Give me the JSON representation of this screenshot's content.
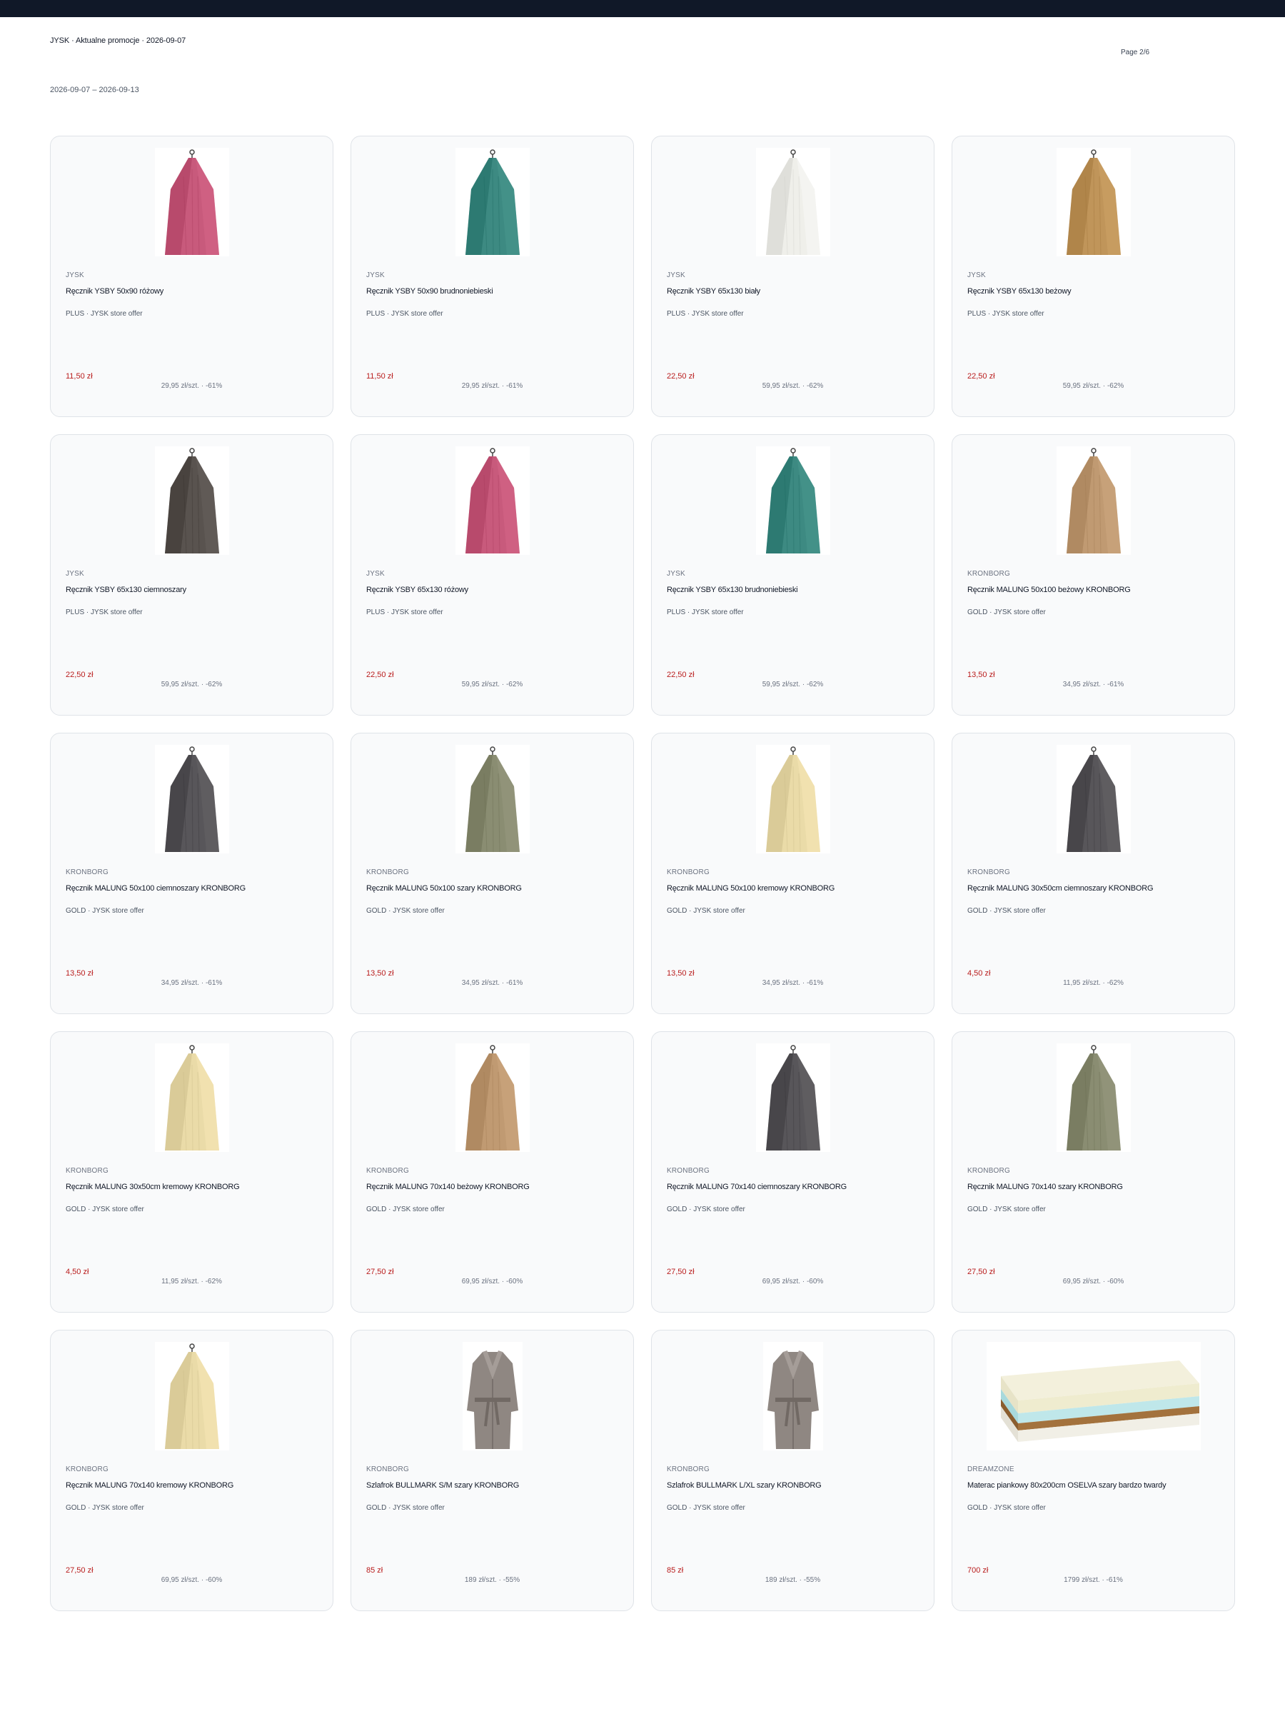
{
  "header": {
    "title": "JYSK · Aktualne promocje · 2026-09-07",
    "page": "Page 2/6",
    "date_range": "2026-09-07 – 2026-09-13"
  },
  "products": [
    {
      "brand": "JYSK",
      "name": "Ręcznik YSBY 50x90 różowy",
      "offer": "PLUS · JYSK store offer",
      "price": "11,50 zł",
      "old": "29,95 zł/szt. · -61%",
      "image": "towel",
      "color": "#c85a7c"
    },
    {
      "brand": "JYSK",
      "name": "Ręcznik YSBY 50x90 brudnoniebieski",
      "offer": "PLUS · JYSK store offer",
      "price": "11,50 zł",
      "old": "29,95 zł/szt. · -61%",
      "image": "towel",
      "color": "#3d8a82"
    },
    {
      "brand": "JYSK",
      "name": "Ręcznik YSBY 65x130 biały",
      "offer": "PLUS · JYSK store offer",
      "price": "22,50 zł",
      "old": "59,95 zł/szt. · -62%",
      "image": "towel",
      "color": "#efefea"
    },
    {
      "brand": "JYSK",
      "name": "Ręcznik YSBY 65x130 beżowy",
      "offer": "PLUS · JYSK store offer",
      "price": "22,50 zł",
      "old": "59,95 zł/szt. · -62%",
      "image": "towel",
      "color": "#c0955a"
    },
    {
      "brand": "JYSK",
      "name": "Ręcznik YSBY 65x130 ciemnoszary",
      "offer": "PLUS · JYSK store offer",
      "price": "22,50 zł",
      "old": "59,95 zł/szt. · -62%",
      "image": "towel",
      "color": "#59534f"
    },
    {
      "brand": "JYSK",
      "name": "Ręcznik YSBY 65x130 różowy",
      "offer": "PLUS · JYSK store offer",
      "price": "22,50 zł",
      "old": "59,95 zł/szt. · -62%",
      "image": "towel",
      "color": "#c85a7c"
    },
    {
      "brand": "JYSK",
      "name": "Ręcznik YSBY 65x130 brudnoniebieski",
      "offer": "PLUS · JYSK store offer",
      "price": "22,50 zł",
      "old": "59,95 zł/szt. · -62%",
      "image": "towel",
      "color": "#3d8a82"
    },
    {
      "brand": "KRONBORG",
      "name": "Ręcznik MALUNG 50x100 beżowy KRONBORG",
      "offer": "GOLD · JYSK store offer",
      "price": "13,50 zł",
      "old": "34,95 zł/szt. · -61%",
      "image": "towel",
      "color": "#c09a72"
    },
    {
      "brand": "KRONBORG",
      "name": "Ręcznik MALUNG 50x100 ciemnoszary KRONBORG",
      "offer": "GOLD · JYSK store offer",
      "price": "13,50 zł",
      "old": "34,95 zł/szt. · -61%",
      "image": "towel",
      "color": "#58565a"
    },
    {
      "brand": "KRONBORG",
      "name": "Ręcznik MALUNG 50x100 szary KRONBORG",
      "offer": "GOLD · JYSK store offer",
      "price": "13,50 zł",
      "old": "34,95 zł/szt. · -61%",
      "image": "towel",
      "color": "#8a8d72"
    },
    {
      "brand": "KRONBORG",
      "name": "Ręcznik MALUNG 50x100 kremowy KRONBORG",
      "offer": "GOLD · JYSK store offer",
      "price": "13,50 zł",
      "old": "34,95 zł/szt. · -61%",
      "image": "towel",
      "color": "#eadba8"
    },
    {
      "brand": "KRONBORG",
      "name": "Ręcznik MALUNG 30x50cm ciemnoszary KRONBORG",
      "offer": "GOLD · JYSK store offer",
      "price": "4,50 zł",
      "old": "11,95 zł/szt. · -62%",
      "image": "towel",
      "color": "#58565a"
    },
    {
      "brand": "KRONBORG",
      "name": "Ręcznik MALUNG 30x50cm kremowy KRONBORG",
      "offer": "GOLD · JYSK store offer",
      "price": "4,50 zł",
      "old": "11,95 zł/szt. · -62%",
      "image": "towel",
      "color": "#eadba8"
    },
    {
      "brand": "KRONBORG",
      "name": "Ręcznik MALUNG 70x140 beżowy KRONBORG",
      "offer": "GOLD · JYSK store offer",
      "price": "27,50 zł",
      "old": "69,95 zł/szt. · -60%",
      "image": "towel",
      "color": "#c09a72"
    },
    {
      "brand": "KRONBORG",
      "name": "Ręcznik MALUNG 70x140 ciemnoszary KRONBORG",
      "offer": "GOLD · JYSK store offer",
      "price": "27,50 zł",
      "old": "69,95 zł/szt. · -60%",
      "image": "towel",
      "color": "#58565a"
    },
    {
      "brand": "KRONBORG",
      "name": "Ręcznik MALUNG 70x140 szary KRONBORG",
      "offer": "GOLD · JYSK store offer",
      "price": "27,50 zł",
      "old": "69,95 zł/szt. · -60%",
      "image": "towel",
      "color": "#8a8d72"
    },
    {
      "brand": "KRONBORG",
      "name": "Ręcznik MALUNG 70x140 kremowy KRONBORG",
      "offer": "GOLD · JYSK store offer",
      "price": "27,50 zł",
      "old": "69,95 zł/szt. · -60%",
      "image": "towel",
      "color": "#eadba8"
    },
    {
      "brand": "KRONBORG",
      "name": "Szlafrok BULLMARK S/M szary KRONBORG",
      "offer": "GOLD · JYSK store offer",
      "price": "85 zł",
      "old": "189 zł/szt. · -55%",
      "image": "bathrobe",
      "color": "#8f8782"
    },
    {
      "brand": "KRONBORG",
      "name": "Szlafrok BULLMARK L/XL szary KRONBORG",
      "offer": "GOLD · JYSK store offer",
      "price": "85 zł",
      "old": "189 zł/szt. · -55%",
      "image": "bathrobe",
      "color": "#8f8782"
    },
    {
      "brand": "DREAMZONE",
      "name": "Materac piankowy 80x200cm OSELVA szary bardzo twardy",
      "offer": "GOLD · JYSK store offer",
      "price": "700 zł",
      "old": "1799 zł/szt. · -61%",
      "image": "mattress",
      "color": "#f3f0dc"
    }
  ]
}
